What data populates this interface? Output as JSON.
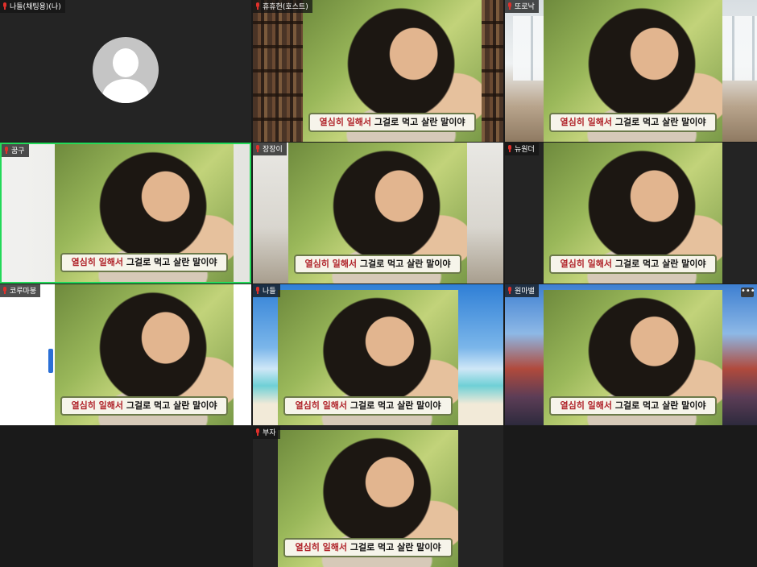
{
  "caption": {
    "highlight": "열심히 일해서",
    "rest": " 그걸로 먹고 살란 말이야"
  },
  "tiles": [
    {
      "name": "나들(채팅용)(나)"
    },
    {
      "name": "휴휴헌(호스트)"
    },
    {
      "name": "또로낙"
    },
    {
      "name": "꿈구"
    },
    {
      "name": "장장이"
    },
    {
      "name": "뉴원더"
    },
    {
      "name": "코루마붕"
    },
    {
      "name": "나들"
    },
    {
      "name": "원마밸"
    },
    {
      "name": "부자"
    }
  ],
  "more_button": "•••",
  "colors": {
    "active_speaker": "#23d959",
    "caption_highlight": "#b0232a",
    "mic_muted": "#e0302b"
  }
}
